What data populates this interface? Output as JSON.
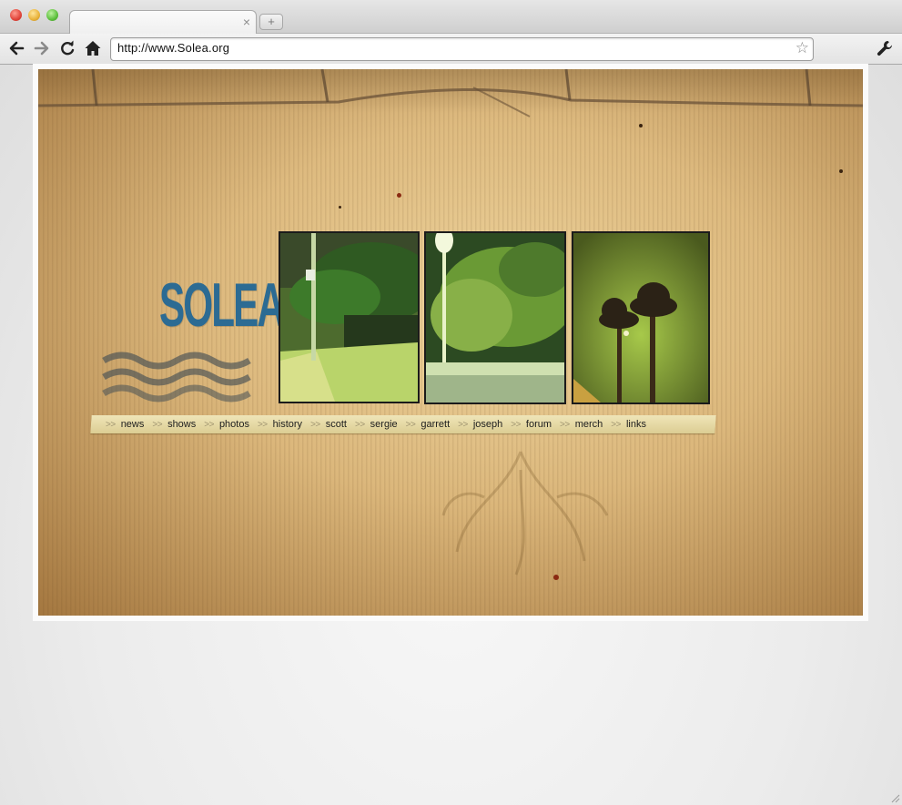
{
  "browser": {
    "new_tab_label": "+",
    "tab_close_label": "×",
    "url": "http://www.Solea.org",
    "back_icon": "arrow-left-icon",
    "forward_icon": "arrow-right-icon",
    "reload_icon": "reload-icon",
    "home_icon": "home-icon",
    "bookmark_icon": "star-icon",
    "menu_icon": "wrench-icon"
  },
  "site": {
    "logo": "SOLEA",
    "nav_separator": ">>",
    "nav": [
      "news",
      "shows",
      "photos",
      "history",
      "scott",
      "sergie",
      "garrett",
      "joseph",
      "forum",
      "merch",
      "links"
    ]
  },
  "colors": {
    "logo_blue": "#2c6b93",
    "paper": "#d9b67e",
    "nav_strip": "#e8dcaa"
  }
}
